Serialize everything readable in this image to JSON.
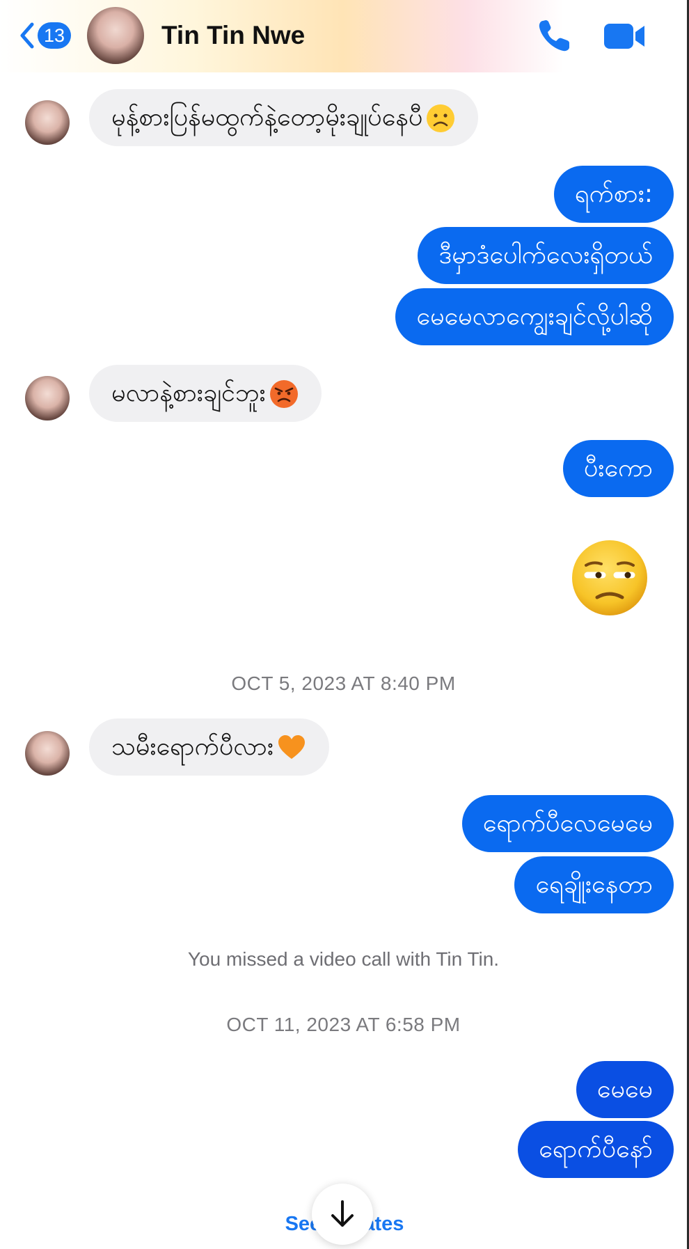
{
  "header": {
    "back_count": "13",
    "contact_name": "Tin Tin Nwe"
  },
  "messages": [
    {
      "text": "မုန့်စားပြန်မထွက်နဲ့တော့မိုးချုပ်နေပီ",
      "emoji": "frowning-face"
    },
    {
      "text": "ရက်စား:"
    },
    {
      "text": "ဒီမှာဒံပေါက်လေးရှိတယ်"
    },
    {
      "text": "မေမေလာကျွေးချင်လို့ပါဆို"
    },
    {
      "text": "မလာနဲ့စားချင်ဘူး",
      "emoji": "angry-face"
    },
    {
      "text": "ပီးကော"
    },
    {
      "emoji": "unamused-face"
    },
    {
      "text": "သမီးရောက်ပီလား",
      "emoji": "orange-heart"
    },
    {
      "text": "ရောက်ပီလေမေမေ"
    },
    {
      "text": "ရေချိုးနေတာ"
    },
    {
      "text": "မေမေ"
    },
    {
      "text": "ရောက်ပီနော်"
    }
  ],
  "timestamps": {
    "first": "OCT 5, 2023 AT 8:40 PM",
    "second": "OCT 11, 2023 AT 6:58 PM"
  },
  "system": {
    "missed_call": "You missed a video call with Tin Tin."
  },
  "footer": {
    "see_updates": "See updates"
  },
  "colors": {
    "accent": "#1877f2",
    "outgoing_bubble": "#0a6af0",
    "outgoing_bubble_dark": "#0a4fe3",
    "incoming_bubble": "#f0f0f2"
  }
}
